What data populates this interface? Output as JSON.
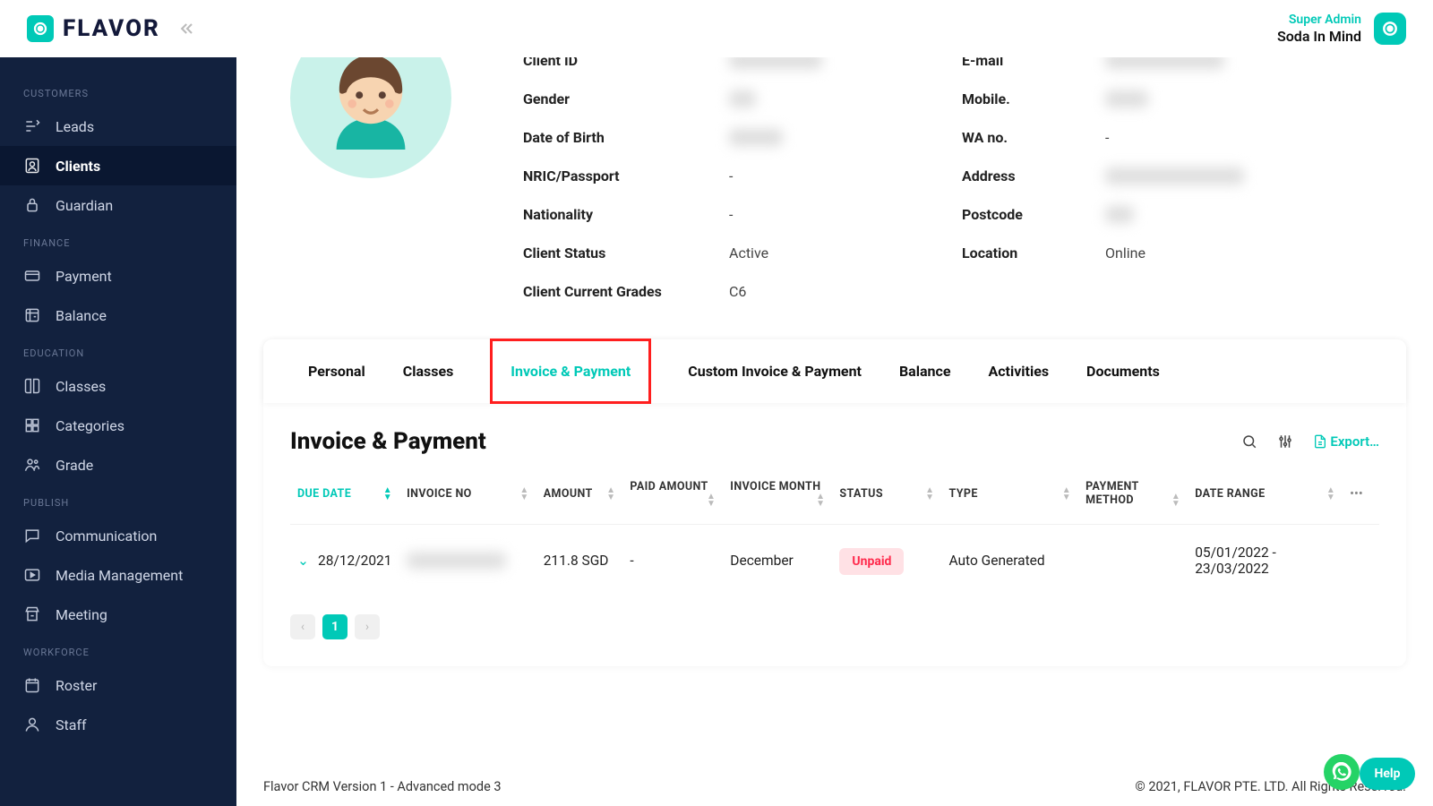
{
  "brand": {
    "name": "FLAVOR"
  },
  "user": {
    "role": "Super Admin",
    "name": "Soda In Mind"
  },
  "sidebar": {
    "sections": [
      {
        "title": "CUSTOMERS",
        "items": [
          {
            "icon": "leads-icon",
            "label": "Leads"
          },
          {
            "icon": "clients-icon",
            "label": "Clients",
            "active": true
          },
          {
            "icon": "guardian-icon",
            "label": "Guardian"
          }
        ]
      },
      {
        "title": "FINANCE",
        "items": [
          {
            "icon": "card-icon",
            "label": "Payment"
          },
          {
            "icon": "safe-icon",
            "label": "Balance"
          }
        ]
      },
      {
        "title": "EDUCATION",
        "items": [
          {
            "icon": "book-icon",
            "label": "Classes"
          },
          {
            "icon": "grid-icon",
            "label": "Categories"
          },
          {
            "icon": "grade-icon",
            "label": "Grade"
          }
        ]
      },
      {
        "title": "PUBLISH",
        "items": [
          {
            "icon": "comment-icon",
            "label": "Communication"
          },
          {
            "icon": "media-icon",
            "label": "Media Management"
          },
          {
            "icon": "meeting-icon",
            "label": "Meeting"
          }
        ]
      },
      {
        "title": "WORKFORCE",
        "items": [
          {
            "icon": "calendar-icon",
            "label": "Roster"
          },
          {
            "icon": "staff-icon",
            "label": "Staff"
          }
        ]
      }
    ]
  },
  "client": {
    "left_fields": [
      {
        "label": "Client ID",
        "blurred": true,
        "placeholder": "XXXXXXX XXX"
      },
      {
        "label": "Gender",
        "blurred": true,
        "placeholder": "XXX"
      },
      {
        "label": "Date of Birth",
        "blurred": true,
        "placeholder": "XXXXXX"
      },
      {
        "label": "NRIC/Passport",
        "value": "-"
      },
      {
        "label": "Nationality",
        "value": "-"
      },
      {
        "label": "Client Status",
        "value": "Active"
      },
      {
        "label": "Client Current Grades",
        "value": "C6"
      }
    ],
    "right_fields": [
      {
        "label": "E-mail",
        "blurred": true,
        "placeholder": "xxxxxxxxxxxx@xxx"
      },
      {
        "label": "Mobile.",
        "blurred": true,
        "placeholder": "xxxxxx"
      },
      {
        "label": "WA no.",
        "value": "-"
      },
      {
        "label": "Address",
        "blurred": true,
        "placeholder": "xxxxx xxxxxx xxxxx xx"
      },
      {
        "label": "Postcode",
        "blurred": true,
        "placeholder": "xxxx"
      },
      {
        "label": "Location",
        "value": "Online"
      }
    ]
  },
  "tabs": [
    {
      "label": "Personal"
    },
    {
      "label": "Classes"
    },
    {
      "label": "Invoice & Payment",
      "active": true,
      "highlighted": true
    },
    {
      "label": "Custom Invoice & Payment"
    },
    {
      "label": "Balance"
    },
    {
      "label": "Activities"
    },
    {
      "label": "Documents"
    }
  ],
  "section_title": "Invoice & Payment",
  "export_label": "Export…",
  "table": {
    "columns": [
      "DUE DATE",
      "INVOICE NO",
      "AMOUNT",
      "PAID AMOUNT",
      "INVOICE MONTH",
      "STATUS",
      "TYPE",
      "PAYMENT METHOD",
      "DATE RANGE"
    ],
    "rows": [
      {
        "due_date": "28/12/2021",
        "invoice_no_blurred": true,
        "invoice_no_placeholder": "XXXXXXXX-XXX",
        "amount": "211.8 SGD",
        "paid_amount": "-",
        "invoice_month": "December",
        "status": "Unpaid",
        "type": "Auto Generated",
        "payment_method": "",
        "date_range": "05/01/2022 - 23/03/2022"
      }
    ]
  },
  "pagination": {
    "current": "1"
  },
  "footer": {
    "left": "Flavor CRM Version 1 - Advanced mode 3",
    "right": "© 2021, FLAVOR PTE. LTD. All Rights Reserved."
  },
  "help_label": "Help"
}
